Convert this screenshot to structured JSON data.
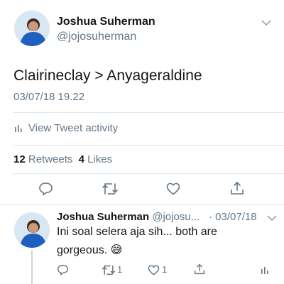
{
  "tweet": {
    "author_name": "Joshua Suherman",
    "author_handle": "@jojosuherman",
    "text": "Clairineclay > Anyageraldine",
    "timestamp": "03/07/18 19.22",
    "activity_label": "View Tweet activity",
    "retweets_count": "12",
    "retweets_label": "Retweets",
    "likes_count": "4",
    "likes_label": "Likes"
  },
  "reply": {
    "author_name": "Joshua Suherman",
    "author_handle": "@jojosu...",
    "separator": "·",
    "date": "03/07/18",
    "text_line1": "Ini soal selera aja sih... both are",
    "text_line2": "gorgeous.",
    "emoji": "😅",
    "retweet_count": "1",
    "like_count": "1"
  },
  "colors": {
    "accent": "#1da1f2",
    "text": "#14171a",
    "muted": "#657786",
    "divider": "#e1e8ed",
    "thread_line": "#cdd8e0"
  },
  "icons": [
    "chevron-down-icon",
    "bar-chart-icon",
    "reply-icon",
    "retweet-icon",
    "like-icon",
    "share-icon"
  ]
}
